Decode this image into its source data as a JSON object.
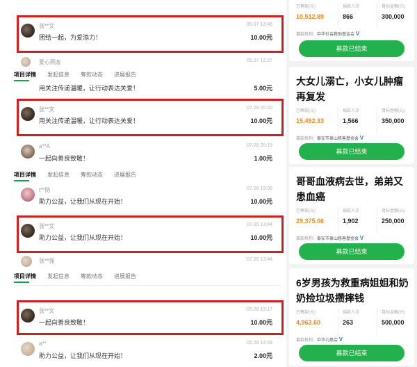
{
  "left": {
    "tabs": [
      "项目详情",
      "发起信息",
      "筹款动态",
      "进展报告"
    ],
    "rows": [
      {
        "user": "张**文",
        "time": "05-07 13:46",
        "message": "团结一起，为爱添力！",
        "amount": "10.00元"
      },
      {
        "user": "爱心网友",
        "time": "05.07 12:27",
        "message": "",
        "amount": ""
      },
      {
        "user": "",
        "time": "",
        "message": "用关注传递温暖，让行动表达关爱！",
        "amount": "5.00元"
      },
      {
        "user": "张**文",
        "time": "07.28 20:20",
        "message": "用关注传递温暖，让行动表达关爱！",
        "amount": "10.00元"
      },
      {
        "user": "a**A",
        "time": "07.28 20:19",
        "message": "一起向善良致敬！",
        "amount": "1.00元"
      },
      {
        "user": "t**防",
        "time": "07.06 19:06",
        "message": "助力公益，让我们从现在开始！",
        "amount": "10.00元"
      },
      {
        "user": "张**文",
        "time": "07.05 13:44",
        "message": "助力公益，让我们从现在开始！",
        "amount": "10.00元"
      },
      {
        "user": "张**强",
        "time": "07.05 13:44",
        "message": "",
        "amount": ""
      },
      {
        "user": "张**文",
        "time": "05.28 15:17",
        "message": "一起向善良致敬！",
        "amount": "10.00元"
      },
      {
        "user": "a**",
        "time": "05.28 14:58",
        "message": "助力公益，让我们从现在开始！",
        "amount": "2.00元"
      }
    ]
  },
  "right": {
    "cards": [
      {
        "title": "",
        "stats": [
          {
            "label": "已筹款(元)",
            "value": "10,512.89"
          },
          {
            "label": "捐款人次",
            "value": "866"
          },
          {
            "label": "目标金额(元)",
            "value": "300,000"
          }
        ],
        "org_label": "募款机构：",
        "org": "中华社会救助基金会",
        "verified": "V",
        "button": "募款已结束"
      },
      {
        "title": "大女儿溺亡，小女儿肿瘤再复发",
        "stats": [
          {
            "label": "已筹款(元)",
            "value": "15,492.33"
          },
          {
            "label": "捐款人次",
            "value": "1,566"
          },
          {
            "label": "目标金额(元)",
            "value": "350,000"
          }
        ],
        "org_label": "募款机构：",
        "org": "泰安市泰山慈善基金会",
        "verified": "V",
        "button": "募款已结束"
      },
      {
        "title": "哥哥血液病去世，弟弟又患血癌",
        "stats": [
          {
            "label": "已筹款(元)",
            "value": "29,375.06"
          },
          {
            "label": "捐款人次",
            "value": "1,902"
          },
          {
            "label": "目标金额(元)",
            "value": "250,000"
          }
        ],
        "org_label": "募款机构：",
        "org": "泰安市泰山慈善基金会",
        "verified": "V",
        "button": "募款已结束"
      },
      {
        "title": "6岁男孩为救重病姐姐和奶奶捡垃圾攒摔钱",
        "stats": [
          {
            "label": "已筹款(元)",
            "value": "4,963.60"
          },
          {
            "label": "捐款人次",
            "value": "263"
          },
          {
            "label": "目标金额(元)",
            "value": "500,000"
          }
        ],
        "org_label": "募款机构：",
        "org": "中华儿慈会",
        "verified": "V",
        "button": "募款已结束"
      }
    ]
  },
  "colors": {
    "highlight_border": "#d11f1f",
    "button_green": "#22b14c",
    "amount_orange": "#e8891b"
  }
}
